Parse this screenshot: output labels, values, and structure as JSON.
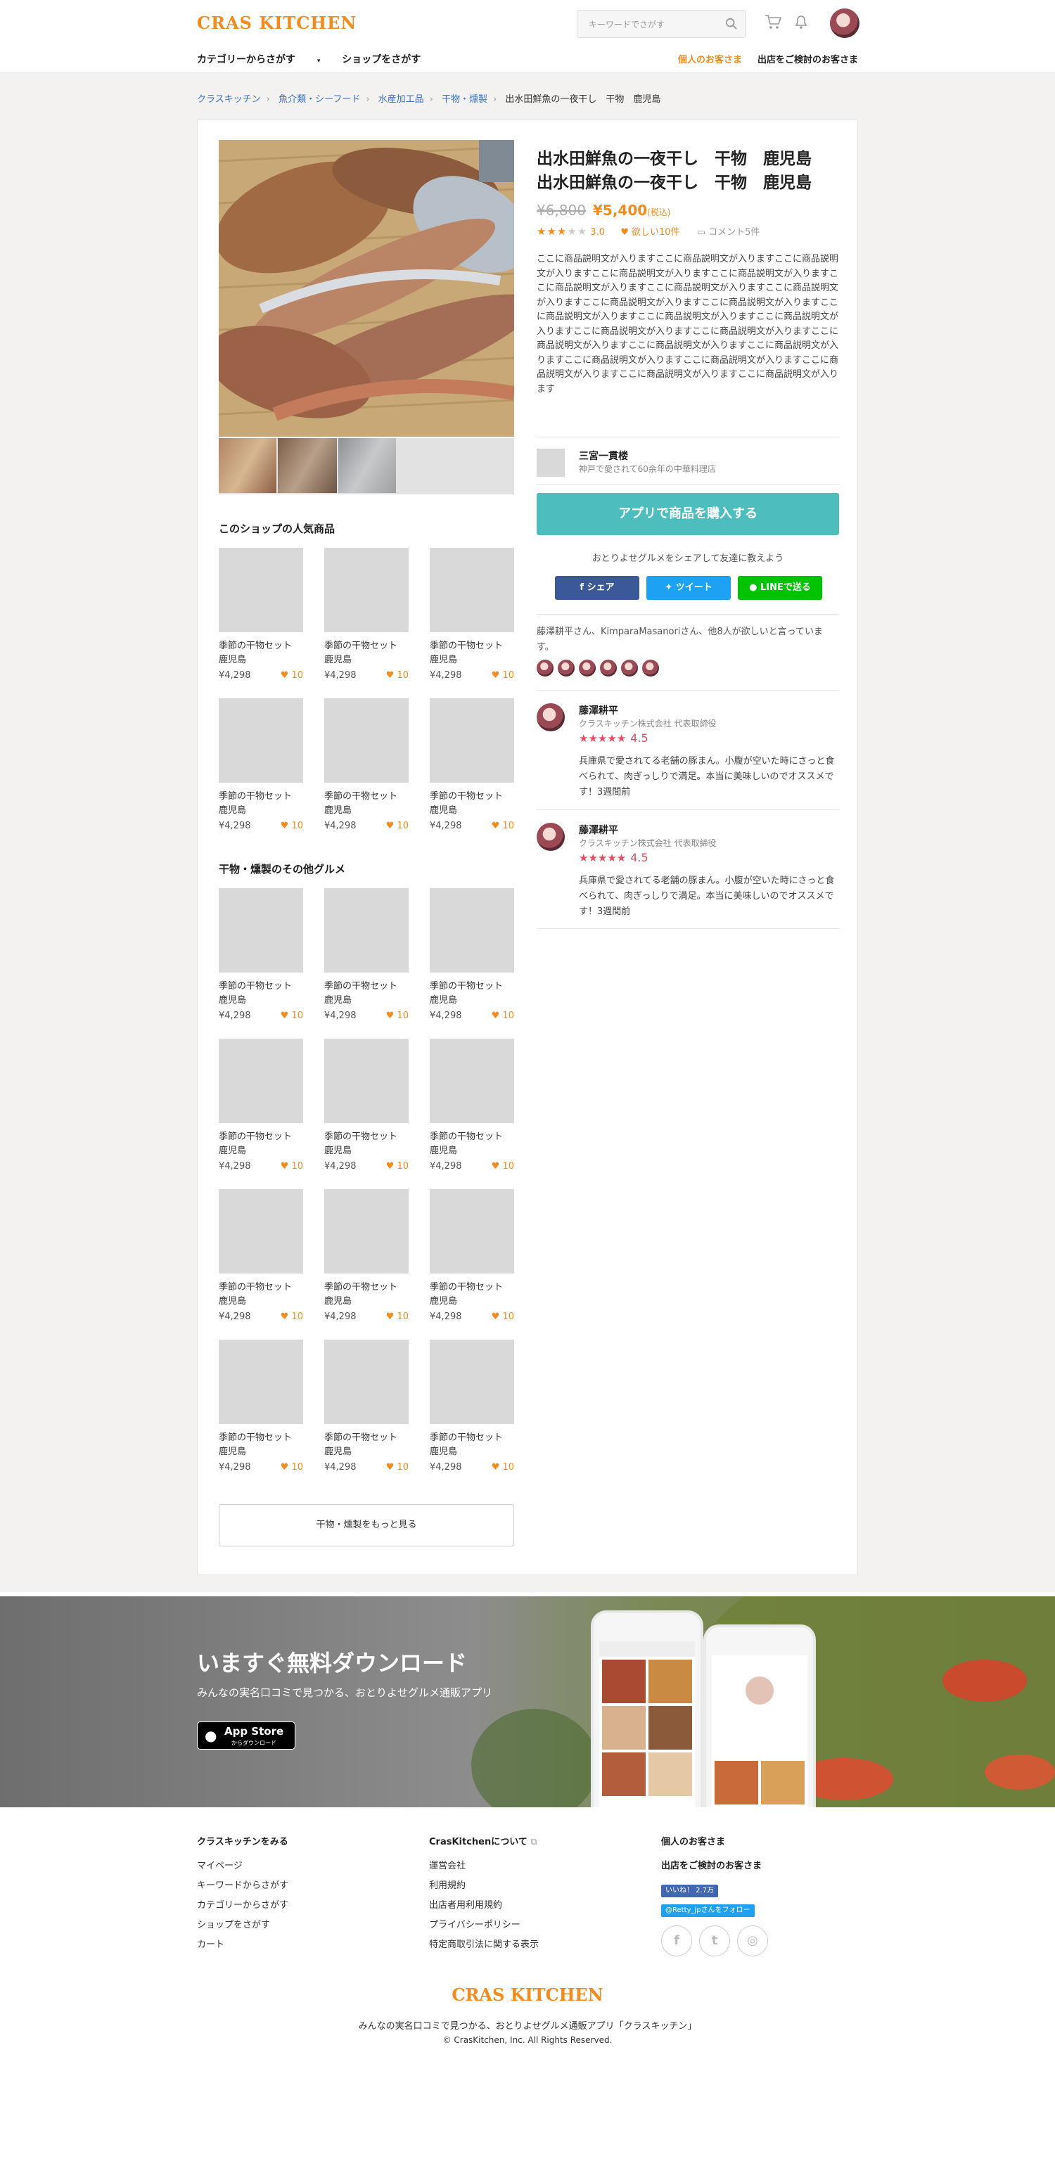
{
  "header": {
    "logo": "CRAS KITCHEN",
    "search_placeholder": "キーワードでさがす",
    "nav": [
      "カテゴリーからさがす",
      "ショップをさがす"
    ],
    "nav_right": [
      "個人のお客さま",
      "出店をご検討のお客さま"
    ]
  },
  "breadcrumb": [
    "クラスキッチン",
    "魚介類・シーフード",
    "水産加工品",
    "干物・燻製",
    "出水田鮮魚の一夜干し　干物　鹿児島"
  ],
  "product": {
    "title_line1": "出水田鮮魚の一夜干し　干物　鹿児島",
    "title_line2": "出水田鮮魚の一夜干し　干物　鹿児島",
    "old_price": "¥6,800",
    "price": "¥5,400",
    "tax": "(税込)",
    "rating": "3.0",
    "rating_value": 3,
    "wish": "欲しい10件",
    "comments": "コメント5件",
    "description": "ここに商品説明文が入りますここに商品説明文が入りますここに商品説明文が入りますここに商品説明文が入りますここに商品説明文が入りますここに商品説明文が入りますここに商品説明文が入りますここに商品説明文が入りますここに商品説明文が入りますここに商品説明文が入りますここに商品説明文が入りますここに商品説明文が入りますここに商品説明文が入りますここに商品説明文が入りますここに商品説明文が入りますここに商品説明文が入りますここに商品説明文が入りますここに商品説明文が入りますここに商品説明文が入りますここに商品説明文が入りますここに商品説明文が入りますここに商品説明文が入りますここに商品説明文が入ります"
  },
  "shop": {
    "name": "三宮一貫楼",
    "subtitle": "神戸で愛されて60余年の中華料理店"
  },
  "buy_label": "アプリで商品を購入する",
  "share": {
    "text": "おとりよせグルメをシェアして友達に教えよう",
    "facebook": "シェア",
    "twitter": "ツイート",
    "line": "LINEで送る"
  },
  "likes_text": "藤澤耕平さん、KimparaMasanoriさん、他8人が欲しいと言っています。",
  "reviews": [
    {
      "name": "藤澤耕平",
      "company": "クラスキッチン株式会社 代表取締役",
      "score": "4.5",
      "text": "兵庫県で愛されてる老舗の豚まん。小腹が空いた時にさっと食べられて、肉ぎっしりで満足。本当に美味しいのでオススメです！3週間前"
    },
    {
      "name": "藤澤耕平",
      "company": "クラスキッチン株式会社 代表取締役",
      "score": "4.5",
      "text": "兵庫県で愛されてる老舗の豚まん。小腹が空いた時にさっと食べられて、肉ぎっしりで満足。本当に美味しいのでオススメです！3週間前"
    }
  ],
  "popular_title": "このショップの人気商品",
  "other_title": "干物・燻製のその他グルメ",
  "item": {
    "name1": "季節の干物セット",
    "name2": "鹿児島",
    "price": "¥4,298",
    "likes": "10"
  },
  "more_label": "干物・燻製をもっと見る",
  "banner": {
    "title": "いますぐ無料ダウンロード",
    "subtitle": "みんなの実名口コミで見つかる、おとりよせグルメ通販アプリ",
    "app_small": "App Store",
    "app_sub": "からダウンロード"
  },
  "footer": {
    "col1_title": "クラスキッチンをみる",
    "col1": [
      "マイページ",
      "キーワードからさがす",
      "カテゴリーからさがす",
      "ショップをさがす",
      "カート"
    ],
    "col2_title": "CrasKitchenについて",
    "col2": [
      "運営会社",
      "利用規約",
      "出店者用利用規約",
      "プライバシーポリシー",
      "特定商取引法に関する表示"
    ],
    "col3_title": "個人のお客さま",
    "col3_title2": "出店をご検討のお客さま",
    "fb_badge": "いいね！ 2.7万",
    "tw_badge": "@Retty_jpさんをフォロー",
    "logo": "CRAS KITCHEN",
    "desc": "みんなの実名口コミで見つかる、おとりよせグルメ通販アプリ「クラスキッチン」",
    "copy": "© CrasKitchen, Inc. All Rights Reserved."
  },
  "colors": {
    "accent": "#f28c1e",
    "teal": "#4dbebd",
    "link": "#3a72c4"
  }
}
